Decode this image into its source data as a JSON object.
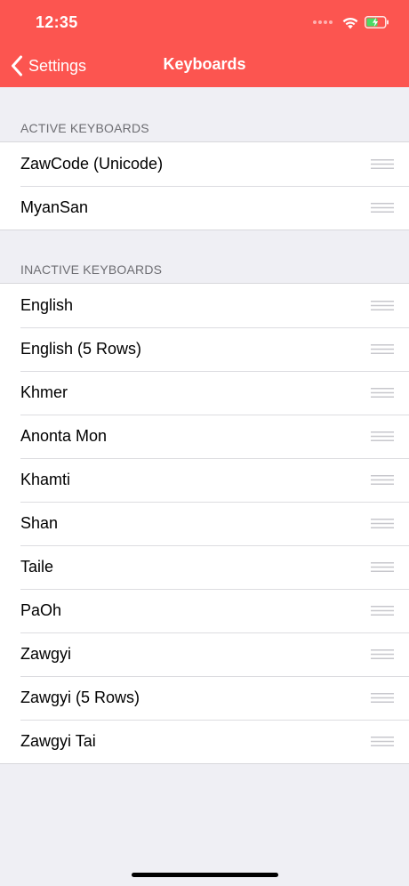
{
  "status_bar": {
    "time": "12:35"
  },
  "nav": {
    "back_label": "Settings",
    "title": "Keyboards"
  },
  "sections": [
    {
      "header": "ACTIVE KEYBOARDS",
      "items": [
        "ZawCode (Unicode)",
        "MyanSan"
      ]
    },
    {
      "header": "INACTIVE KEYBOARDS",
      "items": [
        "English",
        "English (5 Rows)",
        "Khmer",
        "Anonta Mon",
        "Khamti",
        "Shan",
        "Taile",
        "PaOh",
        "Zawgyi",
        "Zawgyi (5 Rows)",
        "Zawgyi Tai"
      ]
    }
  ],
  "icons": {
    "back": "chevron-left-icon",
    "wifi": "wifi-icon",
    "battery": "battery-charging-icon",
    "reorder": "reorder-handle-icon"
  },
  "colors": {
    "header_bg": "#fc5550",
    "background": "#efeff4",
    "battery_fill": "#4cd964"
  }
}
